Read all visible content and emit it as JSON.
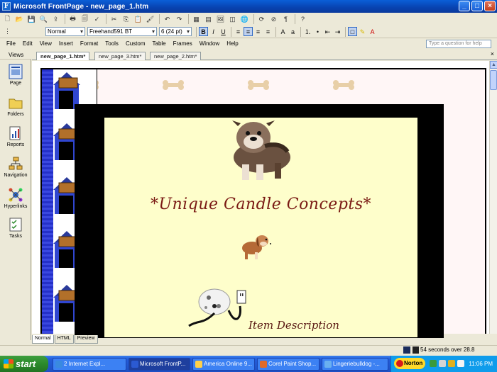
{
  "window": {
    "title": "Microsoft FrontPage - new_page_1.htm"
  },
  "formatting": {
    "style": "Normal",
    "font": "Freehand591 BT",
    "size": "6  (24 pt)"
  },
  "menu": [
    "File",
    "Edit",
    "View",
    "Insert",
    "Format",
    "Tools",
    "Custom",
    "Table",
    "Frames",
    "Window",
    "Help"
  ],
  "help_placeholder": "Type a question for help",
  "views": {
    "header": "Views",
    "items": [
      "Page",
      "Folders",
      "Reports",
      "Navigation",
      "Hyperlinks",
      "Tasks"
    ]
  },
  "tabs": [
    "new_page_1.htm*",
    "new_page_3.htm*",
    "new_page_2.htm*"
  ],
  "page": {
    "title": "*Unique Candle Concepts*",
    "item_label": "Item Description"
  },
  "view_modes": [
    "Normal",
    "HTML",
    "Preview"
  ],
  "status": "54 seconds over 28.8",
  "taskbar": {
    "start": "start",
    "tasks": [
      "2 Internet Expl...",
      "Microsoft FrontP...",
      "America Online 9...",
      "Corel Paint Shop...",
      "Lingeriebulldog -..."
    ],
    "norton": "Norton",
    "clock": "11:06 PM"
  },
  "colors": {
    "title_text": "#7a1a14",
    "content_bg": "#fefecb",
    "page_bg": "#fff6f6",
    "bone": "#e8cfa8"
  }
}
